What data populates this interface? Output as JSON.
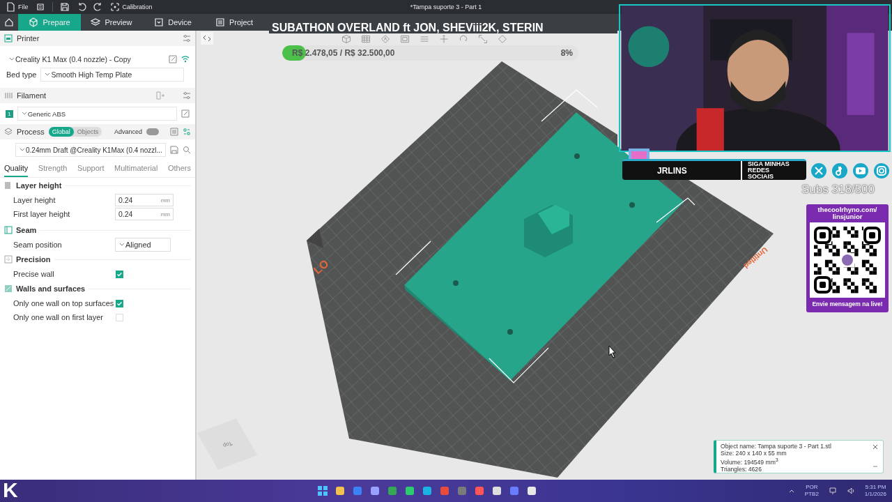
{
  "menu_bar": {
    "file_label": "File",
    "calibration_label": "Calibration",
    "title": "*Tampa suporte 3 - Part 1"
  },
  "tabs": [
    {
      "label": "Prepare",
      "selected": true
    },
    {
      "label": "Preview",
      "selected": false
    },
    {
      "label": "Device",
      "selected": false
    },
    {
      "label": "Project",
      "selected": false
    }
  ],
  "printer": {
    "title": "Printer",
    "preset": "Creality K1 Max (0.4 nozzle) - Copy",
    "bed_type_label": "Bed type",
    "bed_type": "Smooth High Temp Plate"
  },
  "filament": {
    "title": "Filament",
    "items": [
      {
        "index": "1",
        "name": "Generic ABS",
        "color": "#1f9e86"
      }
    ]
  },
  "process": {
    "title": "Process",
    "scope": [
      {
        "label": "Global",
        "selected": true
      },
      {
        "label": "Objects",
        "selected": false
      }
    ],
    "advanced_label": "Advanced",
    "advanced_on": false,
    "preset": "0.24mm Draft @Creality K1Max (0.4 nozzl..."
  },
  "setting_tabs": [
    {
      "label": "Quality",
      "selected": true
    },
    {
      "label": "Strength",
      "selected": false
    },
    {
      "label": "Support",
      "selected": false
    },
    {
      "label": "Multimaterial",
      "selected": false
    },
    {
      "label": "Others",
      "selected": false
    }
  ],
  "groups": [
    {
      "title": "Layer height",
      "settings": [
        {
          "kind": "number",
          "label": "Layer height",
          "value": "0.24",
          "unit": "mm"
        },
        {
          "kind": "number",
          "label": "First layer height",
          "value": "0.24",
          "unit": "mm"
        }
      ]
    },
    {
      "title": "Seam",
      "settings": [
        {
          "kind": "select",
          "label": "Seam position",
          "value": "Aligned"
        }
      ]
    },
    {
      "title": "Precision",
      "settings": [
        {
          "kind": "checkbox",
          "label": "Precise wall",
          "checked": true
        }
      ]
    },
    {
      "title": "Walls and surfaces",
      "settings": [
        {
          "kind": "checkbox",
          "label": "Only one wall on top surfaces",
          "checked": true
        },
        {
          "kind": "checkbox",
          "label": "Only one wall on first layer",
          "checked": false
        }
      ]
    }
  ],
  "viewport": {
    "bed_labels": [
      "LO",
      "Untitled"
    ],
    "view_cube": "Top"
  },
  "overlay": {
    "banner": "SUBATHON OVERLAND ft JON, SHEViii2K, STERIN",
    "goal": {
      "text": "R$ 2.478,05 / R$ 32.500,00",
      "percent": "8%",
      "level": 0.08
    },
    "channel": "JRLINS",
    "social_label": "SIGA MINHAS REDES SOCIAIS",
    "subs": "Subs 318/500",
    "qr_title": "thecoolrhyno.com/ linsjunior",
    "qr_caption": "Envie mensagem na live!"
  },
  "object_info": {
    "lines": [
      "Object name: Tampa suporte 3 - Part 1.stl",
      "Size: 240 x 140 x 55 mm",
      "Volume: 194549 mm$^{3}$",
      "Triangles: 4626"
    ]
  },
  "taskbar": {
    "logo": "K",
    "language": "POR",
    "layout": "PTB2",
    "time": "5:31 PM",
    "date": "1/1/2026"
  }
}
